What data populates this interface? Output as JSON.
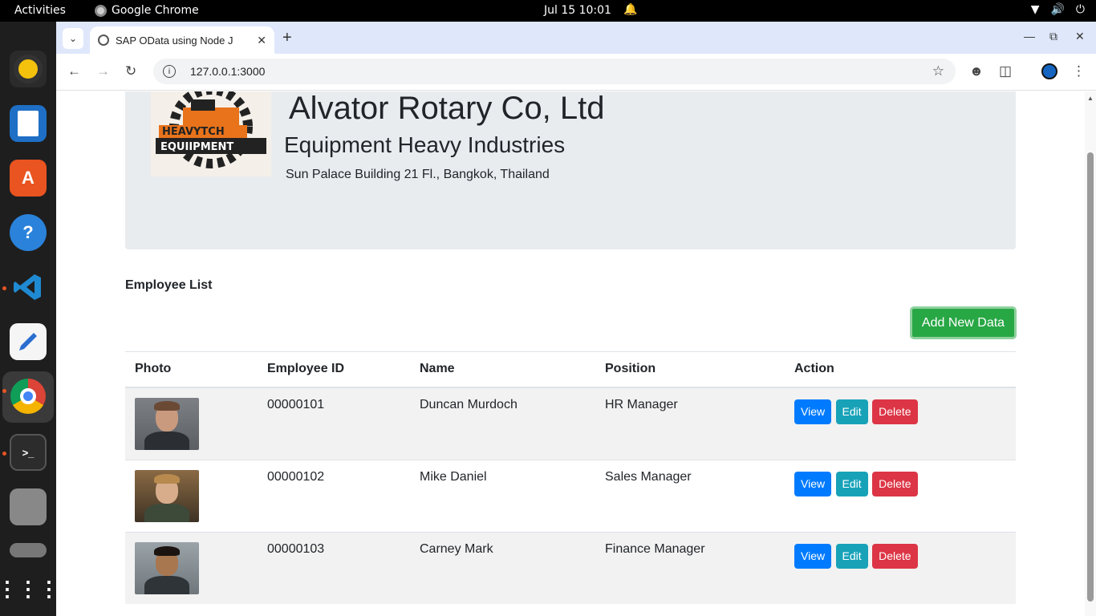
{
  "topbar": {
    "activities": "Activities",
    "app_name": "Google Chrome",
    "clock": "Jul 15  10:01"
  },
  "dock": {
    "items": [
      "rhythmbox-icon",
      "writer-icon",
      "app-center-icon",
      "help-icon",
      "vscode-icon",
      "text-editor-icon",
      "chrome-icon",
      "terminal-icon",
      "files-icon",
      "disk-icon",
      "app-grid-icon"
    ]
  },
  "browser": {
    "tab_title": "SAP OData using Node J",
    "url": "127.0.0.1:3000"
  },
  "header": {
    "company": "Alvator Rotary Co, Ltd",
    "tagline": "Equipment Heavy Industries",
    "address": "Sun Palace Building 21 Fl., Bangkok, Thailand",
    "logo_text_top": "HEAVYTCH",
    "logo_text_bottom": "EQUIIPMENT"
  },
  "employees": {
    "title": "Employee List",
    "add_label": "Add New Data",
    "columns": [
      "Photo",
      "Employee ID",
      "Name",
      "Position",
      "Action"
    ],
    "rows": [
      {
        "id": "00000101",
        "name": "Duncan Murdoch",
        "position": "HR Manager"
      },
      {
        "id": "00000102",
        "name": "Mike Daniel",
        "position": "Sales Manager"
      },
      {
        "id": "00000103",
        "name": "Carney Mark",
        "position": "Finance Manager"
      }
    ],
    "actions": {
      "view": "View",
      "edit": "Edit",
      "delete": "Delete"
    }
  },
  "colors": {
    "view": "#007bff",
    "edit": "#17a2b8",
    "delete": "#dc3545",
    "add": "#28a745",
    "hero_bg": "#e9ecef"
  }
}
